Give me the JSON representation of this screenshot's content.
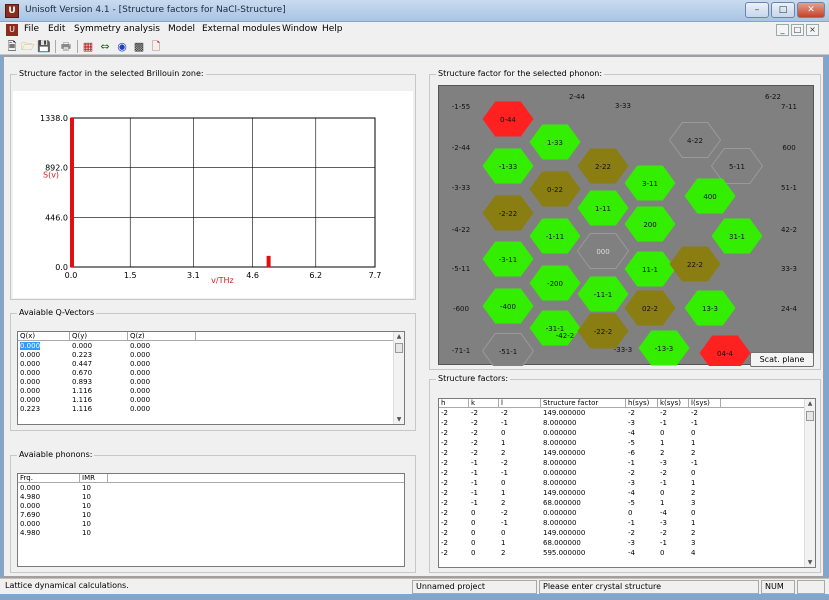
{
  "window": {
    "title": "Unisoft Version 4.1 - [Structure factors for NaCl-Structure]"
  },
  "menubar": [
    "File",
    "Edit",
    "Symmetry analysis",
    "Model",
    "External modules",
    "Window",
    "Help"
  ],
  "sz_panel": {
    "label": "Structure factor in the selected Brillouin zone:",
    "y_ticks": [
      "1338.0",
      "892.0",
      "446.0",
      "0.0"
    ],
    "x_ticks": [
      "0.0",
      "1.5",
      "3.1",
      "4.6",
      "6.2",
      "7.7"
    ],
    "ylabel": "S(v)",
    "xlabel": "v/THz"
  },
  "chart_data": {
    "type": "bar",
    "xlabel": "v/THz",
    "ylabel": "S(v)",
    "xlim": [
      0.0,
      7.7
    ],
    "ylim": [
      0.0,
      1338.0
    ],
    "x": [
      0.0,
      4.98
    ],
    "values": [
      1338.0,
      100.0
    ]
  },
  "qvectors": {
    "label": "Avaiable Q-Vectors",
    "columns": [
      "Q(x)",
      "Q(y)",
      "Q(z)"
    ],
    "rows": [
      [
        "0.000",
        "0.000",
        "0.000"
      ],
      [
        "0.000",
        "0.223",
        "0.000"
      ],
      [
        "0.000",
        "0.447",
        "0.000"
      ],
      [
        "0.000",
        "0.670",
        "0.000"
      ],
      [
        "0.000",
        "0.893",
        "0.000"
      ],
      [
        "0.000",
        "1.116",
        "0.000"
      ],
      [
        "0.000",
        "1.116",
        "0.000"
      ],
      [
        "0.223",
        "1.116",
        "0.000"
      ]
    ]
  },
  "phonons": {
    "label": "Avaiable phonons:",
    "columns": [
      "Frq.",
      "IMR"
    ],
    "rows": [
      [
        "0.000",
        "10"
      ],
      [
        "4.980",
        "10"
      ],
      [
        "0.000",
        "10"
      ],
      [
        "7.690",
        "10"
      ],
      [
        "0.000",
        "10"
      ],
      [
        "4.980",
        "10"
      ]
    ]
  },
  "phonon_panel": {
    "label": "Structure factor for the selected phonon:",
    "scat_button": "Scat. plane",
    "side_labels": [
      "-1-55",
      "-2-44",
      "-3-33",
      "-4-22",
      "-5-11",
      "-600",
      "-71-1",
      "6-22",
      "7-11",
      "600",
      "51-1",
      "42-2",
      "33-3",
      "24-4",
      "2-44",
      "3-33",
      "-42-2",
      "-33-3"
    ],
    "hexes": [
      {
        "label": "0-44",
        "color": "#ff2020"
      },
      {
        "label": "1-33",
        "color": "#33ee00"
      },
      {
        "label": "2-22",
        "color": "#8a7d12"
      },
      {
        "label": "4-22",
        "color": "#808080"
      },
      {
        "label": "-1-33",
        "color": "#33ee00"
      },
      {
        "label": "0-22",
        "color": "#8a7d12"
      },
      {
        "label": "3-11",
        "color": "#33ee00"
      },
      {
        "label": "5-11",
        "color": "#808080"
      },
      {
        "label": "400",
        "color": "#33ee00"
      },
      {
        "label": "-2-22",
        "color": "#8a7d12"
      },
      {
        "label": "-1-11",
        "color": "#33ee00"
      },
      {
        "label": "1-11",
        "color": "#33ee00"
      },
      {
        "label": "200",
        "color": "#33ee00"
      },
      {
        "label": "31-1",
        "color": "#33ee00"
      },
      {
        "label": "-3-11",
        "color": "#33ee00"
      },
      {
        "label": "-200",
        "color": "#33ee00"
      },
      {
        "label": "000",
        "color": "#808080"
      },
      {
        "label": "11-1",
        "color": "#33ee00"
      },
      {
        "label": "22-2",
        "color": "#8a7d12"
      },
      {
        "label": "-400",
        "color": "#33ee00"
      },
      {
        "label": "-11-1",
        "color": "#33ee00"
      },
      {
        "label": "02-2",
        "color": "#8a7d12"
      },
      {
        "label": "-31-1",
        "color": "#33ee00"
      },
      {
        "label": "13-3",
        "color": "#33ee00"
      },
      {
        "label": "-22-2",
        "color": "#8a7d12"
      },
      {
        "label": "-51-1",
        "color": "#808080"
      },
      {
        "label": "-13-3",
        "color": "#33ee00"
      },
      {
        "label": "04-4",
        "color": "#ff2020"
      }
    ]
  },
  "structure_factors": {
    "label": "Structure factors:",
    "columns": [
      "h",
      "k",
      "l",
      "Structure factor",
      "h(sys)",
      "k(sys)",
      "l(sys)"
    ],
    "rows": [
      [
        "-2",
        "-2",
        "-2",
        "149.000000",
        "-2",
        "-2",
        "-2"
      ],
      [
        "-2",
        "-2",
        "-1",
        "8.000000",
        "-3",
        "-1",
        "-1"
      ],
      [
        "-2",
        "-2",
        "0",
        "0.000000",
        "-4",
        "0",
        "0"
      ],
      [
        "-2",
        "-2",
        "1",
        "8.000000",
        "-5",
        "1",
        "1"
      ],
      [
        "-2",
        "-2",
        "2",
        "149.000000",
        "-6",
        "2",
        "2"
      ],
      [
        "-2",
        "-1",
        "-2",
        "8.000000",
        "-1",
        "-3",
        "-1"
      ],
      [
        "-2",
        "-1",
        "-1",
        "0.000000",
        "-2",
        "-2",
        "0"
      ],
      [
        "-2",
        "-1",
        "0",
        "8.000000",
        "-3",
        "-1",
        "1"
      ],
      [
        "-2",
        "-1",
        "1",
        "149.000000",
        "-4",
        "0",
        "2"
      ],
      [
        "-2",
        "-1",
        "2",
        "68.000000",
        "-5",
        "1",
        "3"
      ],
      [
        "-2",
        "0",
        "-2",
        "0.000000",
        "0",
        "-4",
        "0"
      ],
      [
        "-2",
        "0",
        "-1",
        "8.000000",
        "-1",
        "-3",
        "1"
      ],
      [
        "-2",
        "0",
        "0",
        "149.000000",
        "-2",
        "-2",
        "2"
      ],
      [
        "-2",
        "0",
        "1",
        "68.000000",
        "-3",
        "-1",
        "3"
      ],
      [
        "-2",
        "0",
        "2",
        "595.000000",
        "-4",
        "0",
        "4"
      ]
    ]
  },
  "statusbar": {
    "left": "Lattice dynamical calculations.",
    "project": "Unnamed project",
    "message": "Please enter crystal structure",
    "num": "NUM"
  }
}
